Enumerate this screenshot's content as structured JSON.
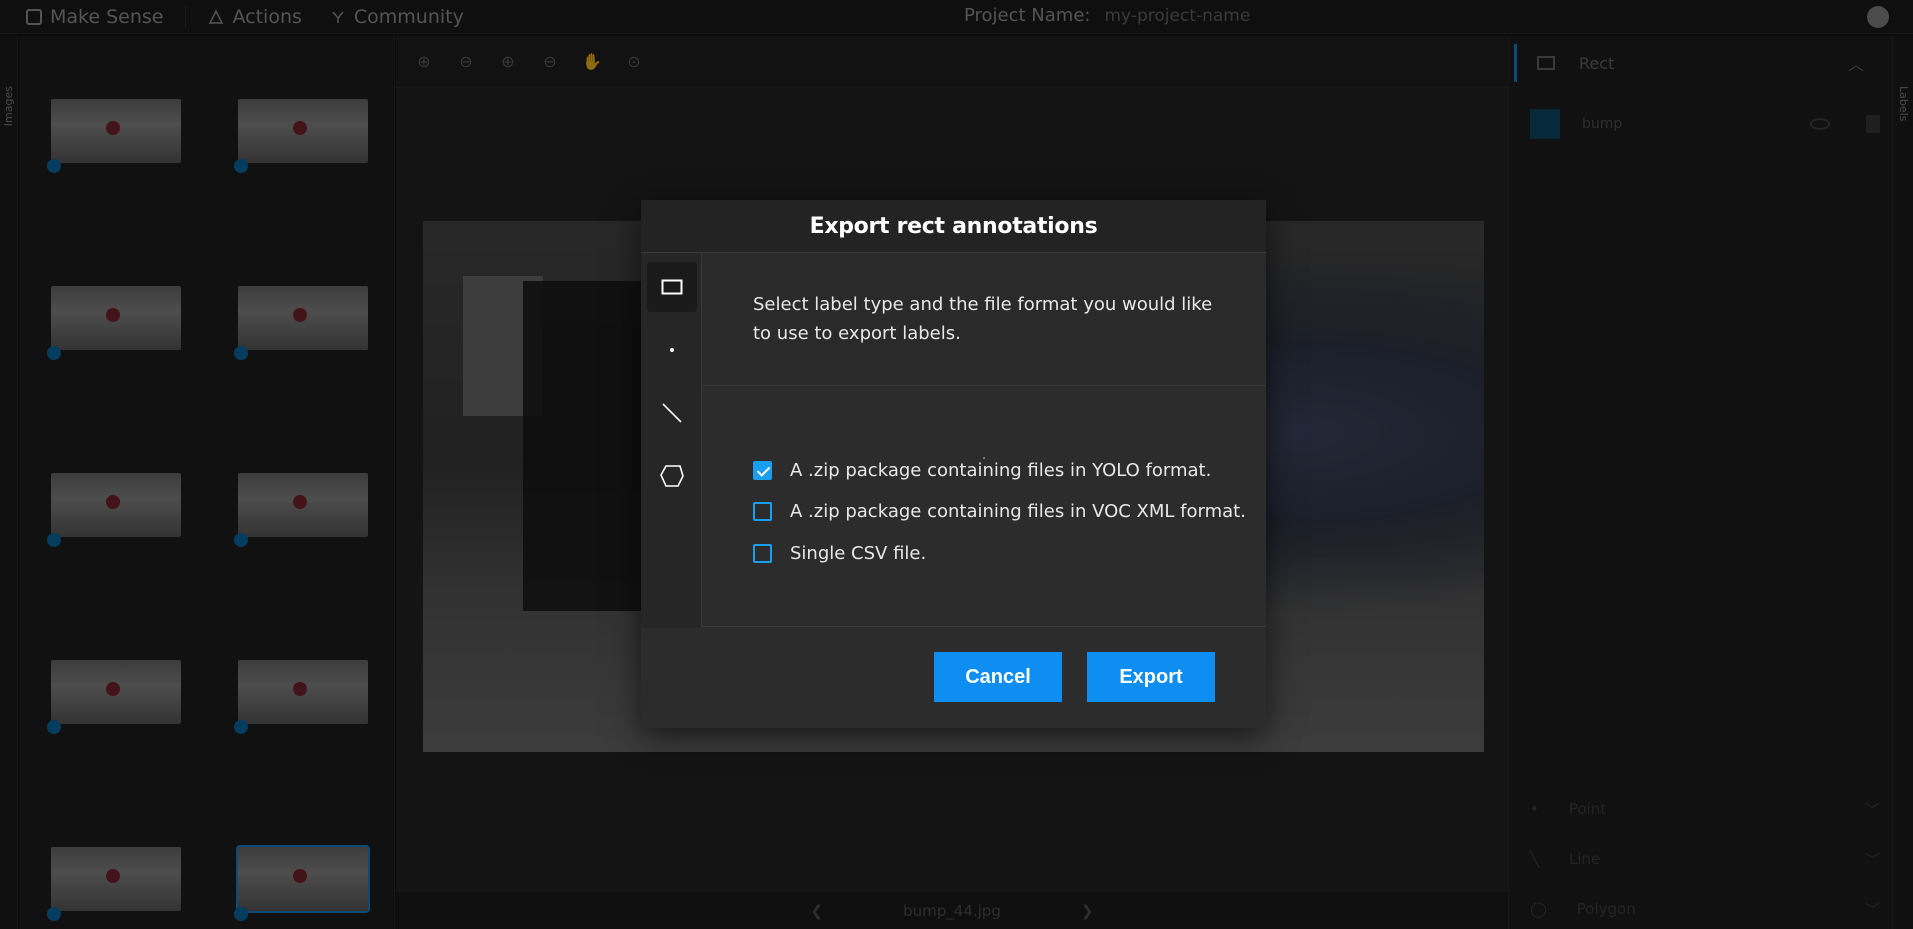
{
  "topbar": {
    "app_name": "Make Sense",
    "nav": [
      "Actions",
      "Community"
    ],
    "project_label": "Project Name:",
    "project_value": "my-project-name"
  },
  "left_sidebar": {
    "tab_label": "Images"
  },
  "right_sidebar": {
    "tab_label": "Labels",
    "header": "Rect",
    "label_name": "bump",
    "label_color": "#0b4d6e",
    "tools": [
      "Point",
      "Line",
      "Polygon"
    ]
  },
  "editor": {
    "filename": "bump_44.jpg"
  },
  "modal": {
    "title": "Export rect annotations",
    "message": "Select label type and the file format you would like to use to export labels.",
    "options": [
      {
        "label": "A .zip package containing files in YOLO format.",
        "checked": true
      },
      {
        "label": "A .zip package containing files in VOC XML format.",
        "checked": false
      },
      {
        "label": "Single CSV file.",
        "checked": false
      }
    ],
    "cancel_label": "Cancel",
    "export_label": "Export"
  },
  "colors": {
    "accent": "#0d8ef0",
    "modal_bg": "#2c2c2c",
    "header_bg": "#232323"
  }
}
